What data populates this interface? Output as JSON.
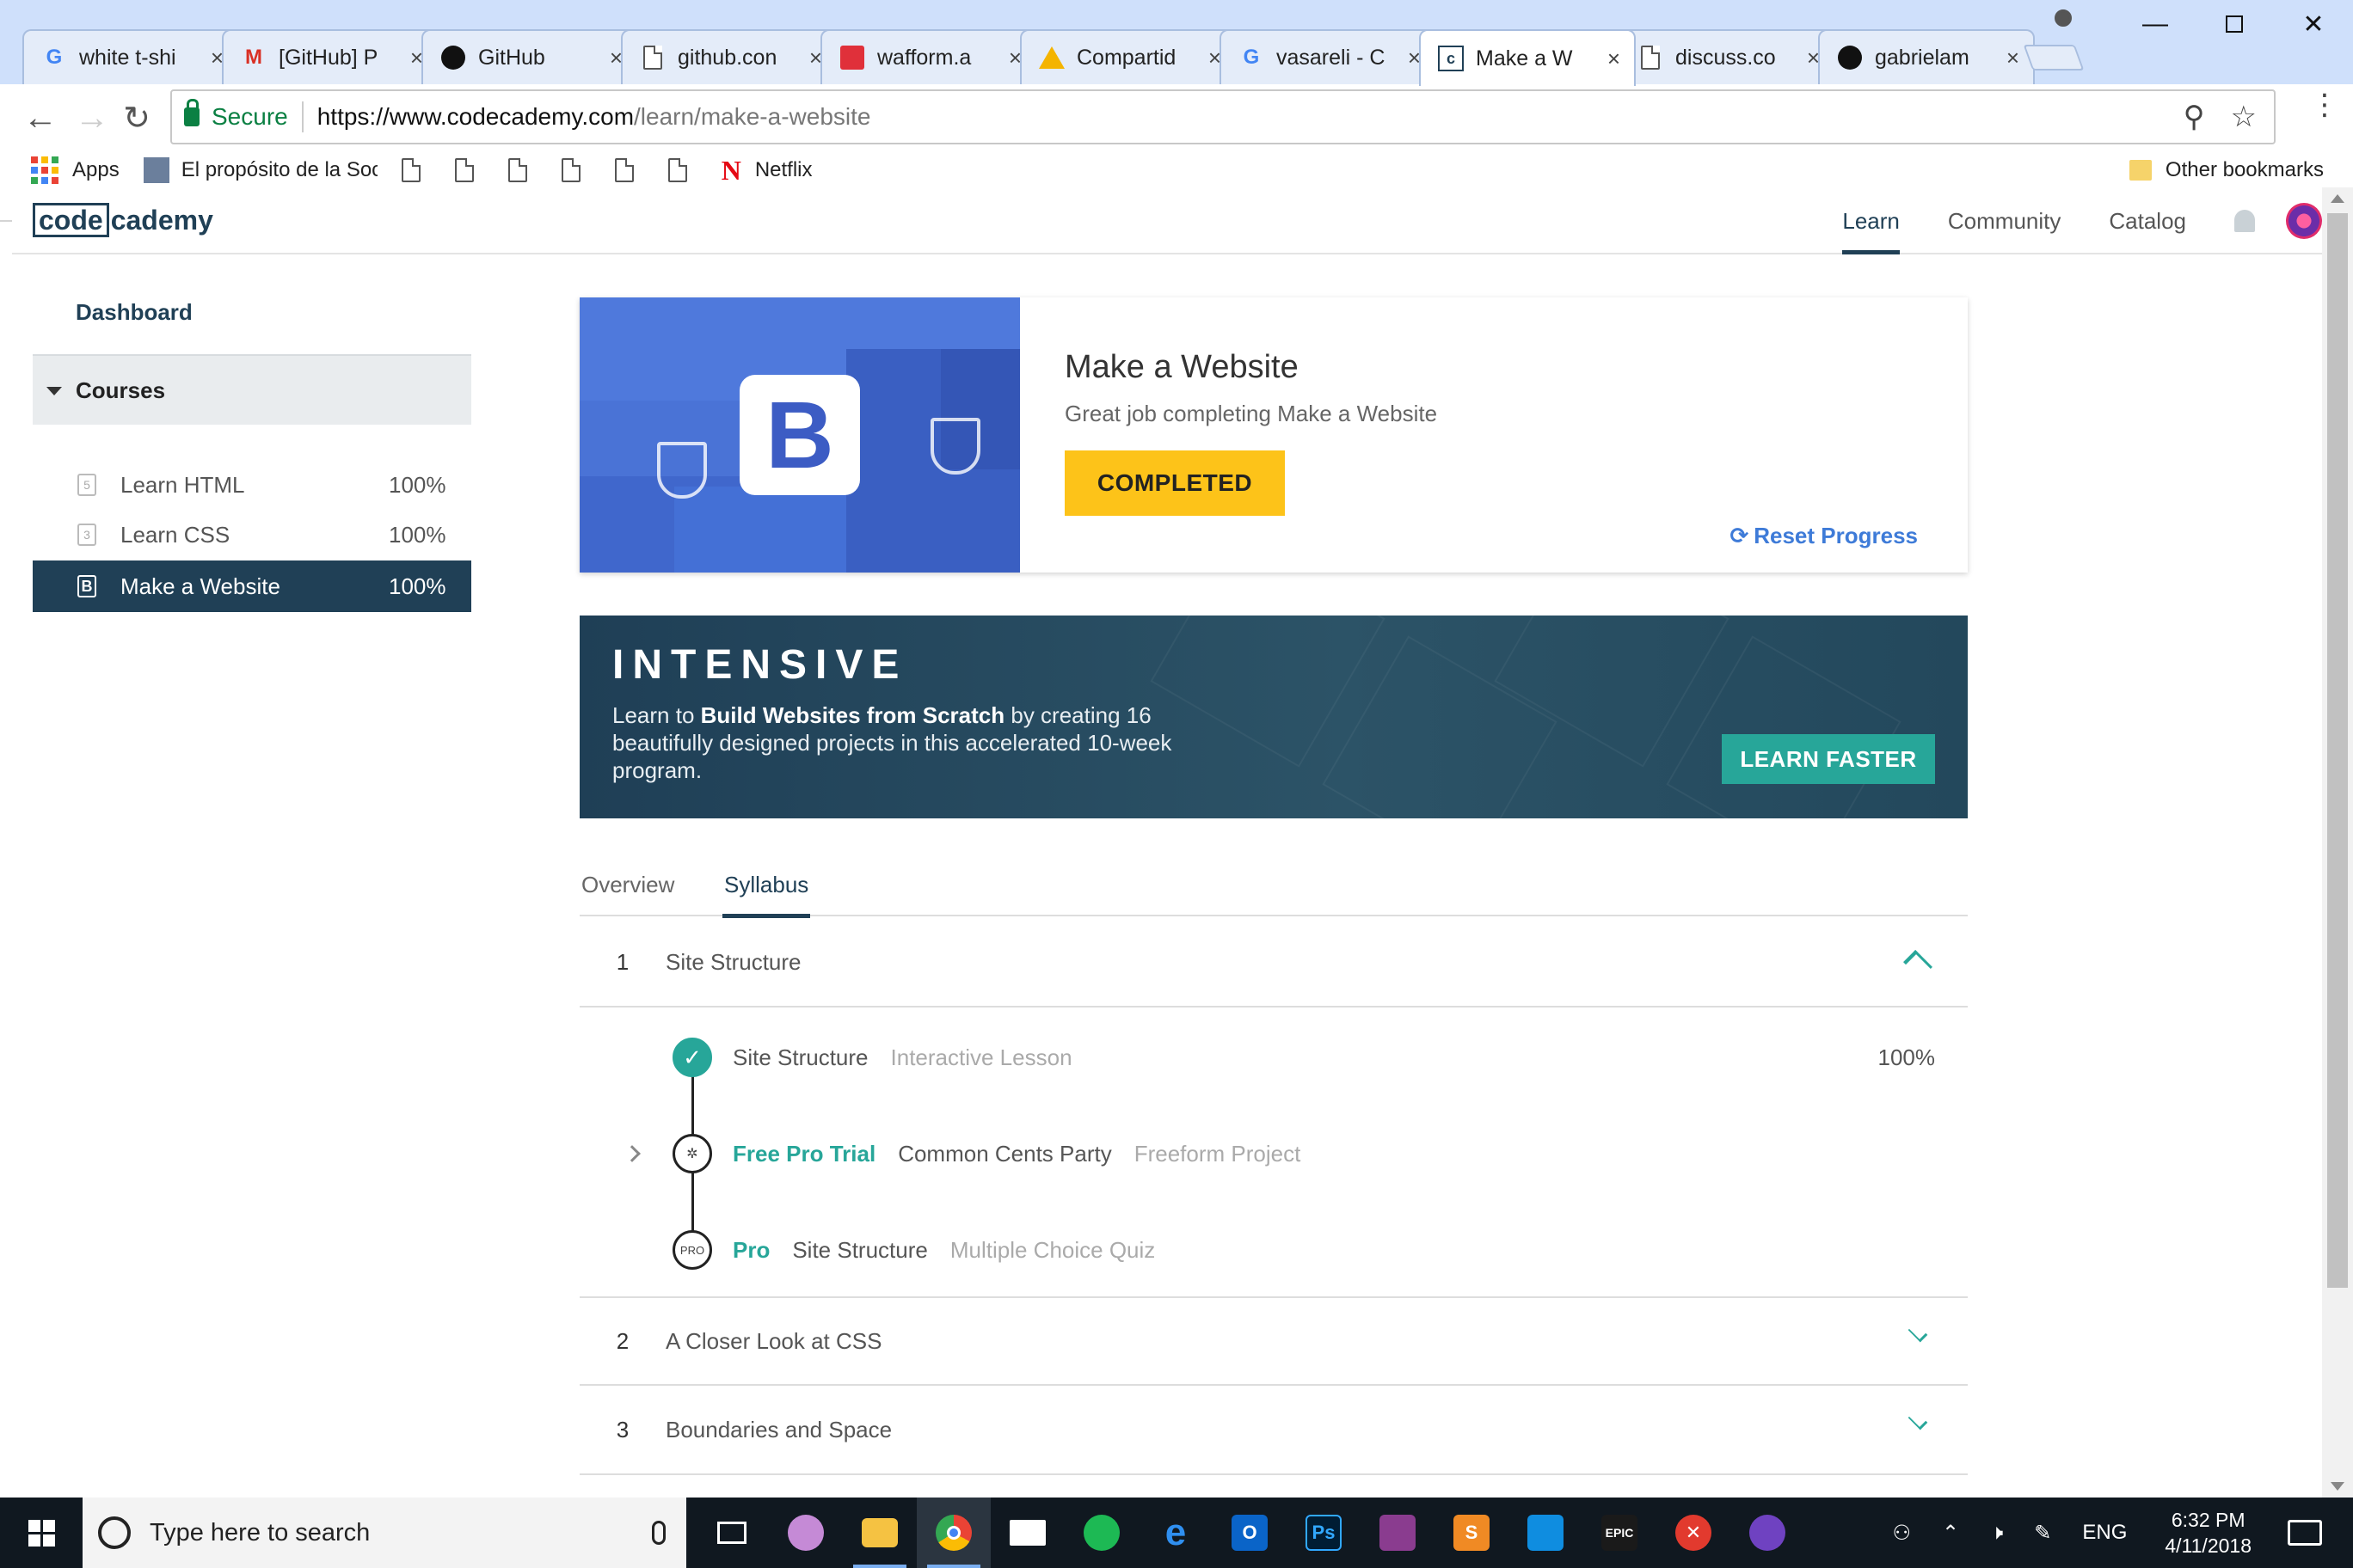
{
  "browser": {
    "tabs": [
      {
        "title": "white t-shi",
        "favicon": "google-g-icon",
        "active": false
      },
      {
        "title": "[GitHub] P",
        "favicon": "gmail-icon",
        "active": false
      },
      {
        "title": "GitHub",
        "favicon": "github-icon",
        "active": false
      },
      {
        "title": "github.con",
        "favicon": "page-icon",
        "active": false
      },
      {
        "title": "wafform.a",
        "favicon": "wafform-icon",
        "active": false
      },
      {
        "title": "Compartid",
        "favicon": "drive-icon",
        "active": false
      },
      {
        "title": "vasareli - C",
        "favicon": "google-g-icon",
        "active": false
      },
      {
        "title": "Make a W",
        "favicon": "codecademy-icon",
        "active": true
      },
      {
        "title": "discuss.co",
        "favicon": "page-icon",
        "active": false
      },
      {
        "title": "gabrielam",
        "favicon": "github-icon",
        "active": false
      }
    ],
    "close_glyph": "×",
    "secure_label": "Secure",
    "url_main": "https://www.codecademy.com",
    "url_rest": "/learn/make-a-website",
    "bookmarks": {
      "apps": "Apps",
      "proposito": "El propósito de la Soc",
      "netflix": "Netflix",
      "other": "Other bookmarks"
    }
  },
  "site": {
    "logo_code": "code",
    "logo_academy": "cademy",
    "nav": {
      "learn": "Learn",
      "community": "Community",
      "catalog": "Catalog"
    }
  },
  "sidebar": {
    "dashboard": "Dashboard",
    "courses_label": "Courses",
    "courses": [
      {
        "name": "Learn HTML",
        "pct": "100%",
        "icon": "html5-icon"
      },
      {
        "name": "Learn CSS",
        "pct": "100%",
        "icon": "css3-icon"
      },
      {
        "name": "Make a Website",
        "pct": "100%",
        "icon": "bootstrap-icon"
      }
    ]
  },
  "hero": {
    "logo_letter": "B",
    "title": "Make a Website",
    "subtitle": "Great job completing Make a Website",
    "button": "COMPLETED",
    "reset": "Reset Progress",
    "reset_glyph": "⟳"
  },
  "intensive": {
    "title": "INTENSIVE",
    "body_pre": "Learn to ",
    "body_bold": "Build Websites from Scratch",
    "body_post": " by creating 16 beautifully designed projects in this accelerated 10-week program.",
    "button": "LEARN FASTER"
  },
  "course_tabs": {
    "overview": "Overview",
    "syllabus": "Syllabus"
  },
  "syllabus": {
    "sections": [
      {
        "num": "1",
        "title": "Site Structure",
        "expanded": true
      },
      {
        "num": "2",
        "title": "A Closer Look at CSS",
        "expanded": false
      },
      {
        "num": "3",
        "title": "Boundaries and Space",
        "expanded": false
      }
    ],
    "lessons": [
      {
        "tag": "",
        "name": "Site Structure",
        "kind": "Interactive Lesson",
        "pct": "100%",
        "node": "✓"
      },
      {
        "tag": "Free Pro Trial",
        "name": "Common Cents Party",
        "kind": "Freeform Project",
        "pct": "",
        "node": "✲"
      },
      {
        "tag": "Pro",
        "name": "Site Structure",
        "kind": "Multiple Choice Quiz",
        "pct": "",
        "node": "PRO"
      }
    ]
  },
  "taskbar": {
    "search_placeholder": "Type here to search",
    "lang": "ENG",
    "time": "6:32 PM",
    "date": "4/11/2018"
  },
  "colors": {
    "navy": "#204056",
    "teal": "#27a699",
    "yellow": "#fdc319",
    "link_blue": "#3e7bd8"
  }
}
